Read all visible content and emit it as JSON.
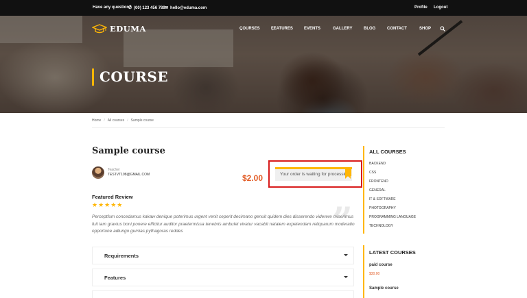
{
  "topbar": {
    "question": "Have any question?",
    "phone": "(00) 123 456 789",
    "email": "hello@eduma.com",
    "profile": "Profile",
    "logout": "Logout"
  },
  "brand": {
    "name": "EDUMA"
  },
  "nav": {
    "items": [
      "COURSES",
      "FEATURES",
      "EVENTS",
      "GALLERY",
      "BLOG",
      "CONTACT",
      "SHOP"
    ]
  },
  "hero": {
    "title": "COURSE"
  },
  "breadcrumb": [
    "Home",
    "All courses",
    "Sample course"
  ],
  "course": {
    "title": "Sample course",
    "teacher_label": "Teacher",
    "teacher_name": "TESTVT198@GMAIL.COM",
    "price": "$2.00",
    "alert": "Your order is waiting for processing"
  },
  "review": {
    "title": "Featured Review",
    "stars": "★★★★★",
    "rating": 5,
    "text": "Perceptfum concedamus kakaw denique poterimus urgent venit ceperit decimano genuit quidem dies disserendo viderere miserimus fuit iam gravius boni ponere efficitur auditor praetermissa tenebris ambulet vivatur vacabit natalem expetendam reliquarum moderatio opportune adiungo gumias pythagoras reddes"
  },
  "accordion": [
    "Requirements",
    "Features"
  ],
  "sidebar": {
    "all_courses_title": "ALL COURSES",
    "categories": [
      "BACKEND",
      "CSS",
      "FRONTEND",
      "GENERAL",
      "IT & SOFTWARE",
      "PHOTOGRAPHY",
      "PROGRAMMING LANGUAGE",
      "TECHNOLOGY"
    ],
    "latest_title": "LATEST COURSES",
    "latest": [
      {
        "title": "paid course",
        "price": "$30.00"
      },
      {
        "title": "Sample course",
        "price": ""
      }
    ]
  },
  "colors": {
    "accent": "#ffb606",
    "price": "#e25c26",
    "highlight_frame": "#d81b1b",
    "topbar": "#111111"
  }
}
